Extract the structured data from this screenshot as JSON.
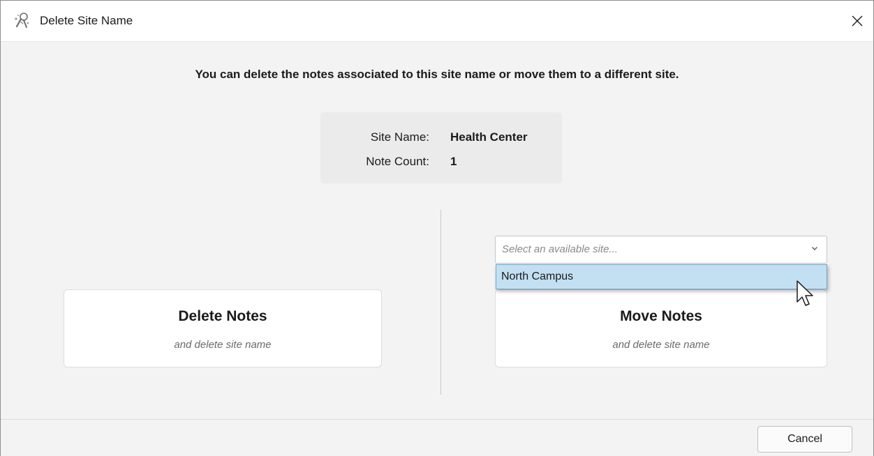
{
  "window": {
    "title": "Delete Site Name"
  },
  "instruction": "You can delete the notes associated to this site name or move them to a different site.",
  "info": {
    "site_name_label": "Site Name:",
    "site_name_value": "Health Center",
    "note_count_label": "Note Count:",
    "note_count_value": "1"
  },
  "delete_card": {
    "title": "Delete Notes",
    "subtitle": "and delete site name"
  },
  "move_card": {
    "select_placeholder": "Select an available site...",
    "dropdown_options": [
      "North Campus"
    ],
    "highlighted_option": "North Campus",
    "title": "Move Notes",
    "subtitle": "and delete site name"
  },
  "footer": {
    "cancel_label": "Cancel"
  },
  "icons": {
    "app": "app-logo-icon",
    "close": "close-icon",
    "dropdown": "chevron-down-icon",
    "cursor": "mouse-cursor-icon"
  },
  "colors": {
    "dialog_bg": "#f3f3f3",
    "titlebar_bg": "#ffffff",
    "info_box_bg": "#ebebeb",
    "dropdown_highlight": "#c2e0f2",
    "dropdown_border": "#6ba9d1"
  }
}
